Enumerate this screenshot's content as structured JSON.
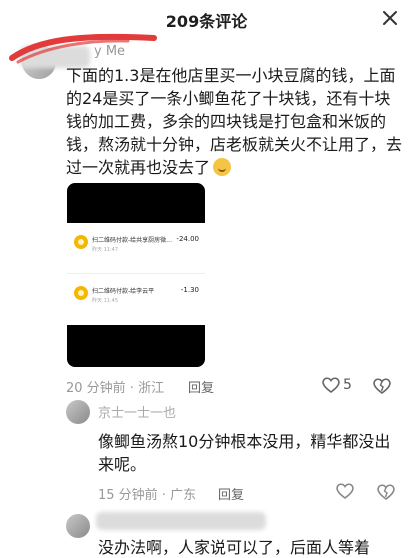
{
  "header": {
    "title": "209条评论"
  },
  "comments": [
    {
      "username": "y Me",
      "text": "下面的1.3是在他店里买一小块豆腐的钱，上面的24是买了一条小鲫鱼花了十块钱，还有十块钱的加工费，多余的四块钱是打包盒和米饭的钱，熬汤就十分钟，店老板就关火不让用了，去过一次就再也没去了",
      "attachment": {
        "transactions": [
          {
            "title": "扫二维码付款-给共享厨房微…",
            "time": "昨天 11:47",
            "amount": "-24.00"
          },
          {
            "title": "扫二维码付款-给李云平",
            "time": "昨天 11:45",
            "amount": "-1.30"
          }
        ]
      },
      "time_location": "20 分钟前 · 浙江",
      "reply_label": "回复",
      "like_count": "5"
    },
    {
      "username": "京士一士一也",
      "text": "像鲫鱼汤熬10分钟根本没用，精华都没出来呢。",
      "time_location": "15 分钟前 · 广东",
      "reply_label": "回复"
    },
    {
      "username": "",
      "text": "没办法啊，人家说可以了，后面人等着"
    }
  ]
}
